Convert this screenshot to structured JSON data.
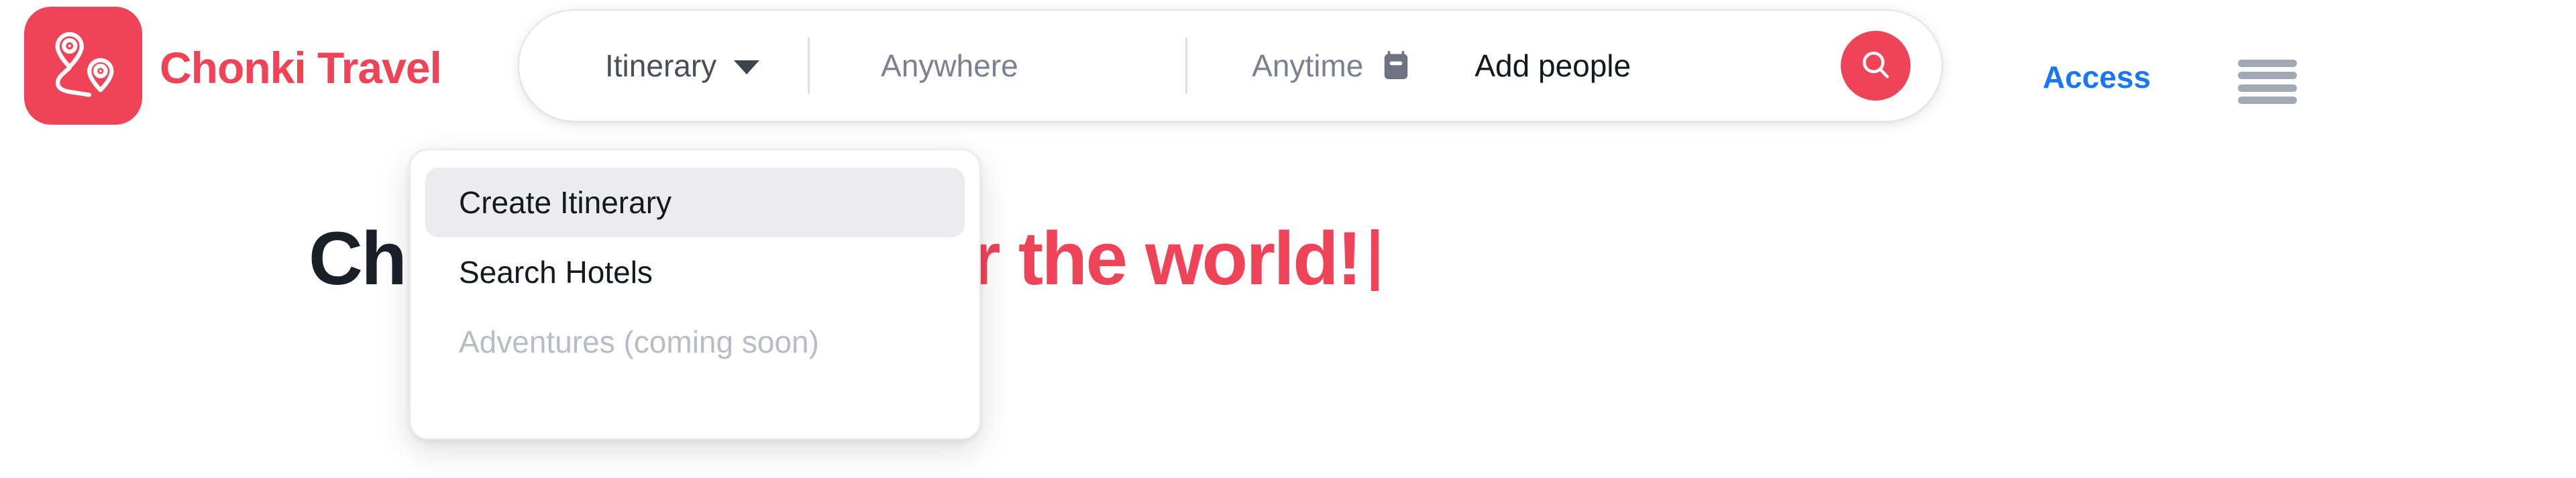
{
  "brand": {
    "name": "Chonki Travel",
    "logo_icon": "map-pins-route-icon",
    "color": "#ef4458"
  },
  "search": {
    "type_selector": {
      "label": "Itinerary",
      "caret_icon": "chevron-down-icon"
    },
    "location": {
      "placeholder": "Anywhere",
      "value": ""
    },
    "dates": {
      "placeholder": "Anytime",
      "value": "",
      "icon": "calendar-icon"
    },
    "guests": {
      "label": "Add people",
      "value": "Add people"
    },
    "submit": {
      "icon": "search-icon",
      "color": "#ef4458"
    }
  },
  "nav": {
    "access_label": "Access",
    "access_color": "#1877f2",
    "menu_icon": "hamburger-menu-icon"
  },
  "hero": {
    "headline_dark": "Ch",
    "headline_accent": "ribe and discover the world!",
    "accent_color": "#ef4458",
    "caret_visible": true
  },
  "dropdown": {
    "items": [
      {
        "label": "Create Itinerary",
        "state": "active"
      },
      {
        "label": "Search Hotels",
        "state": "default"
      },
      {
        "label": "Adventures (coming soon)",
        "state": "disabled"
      }
    ]
  }
}
